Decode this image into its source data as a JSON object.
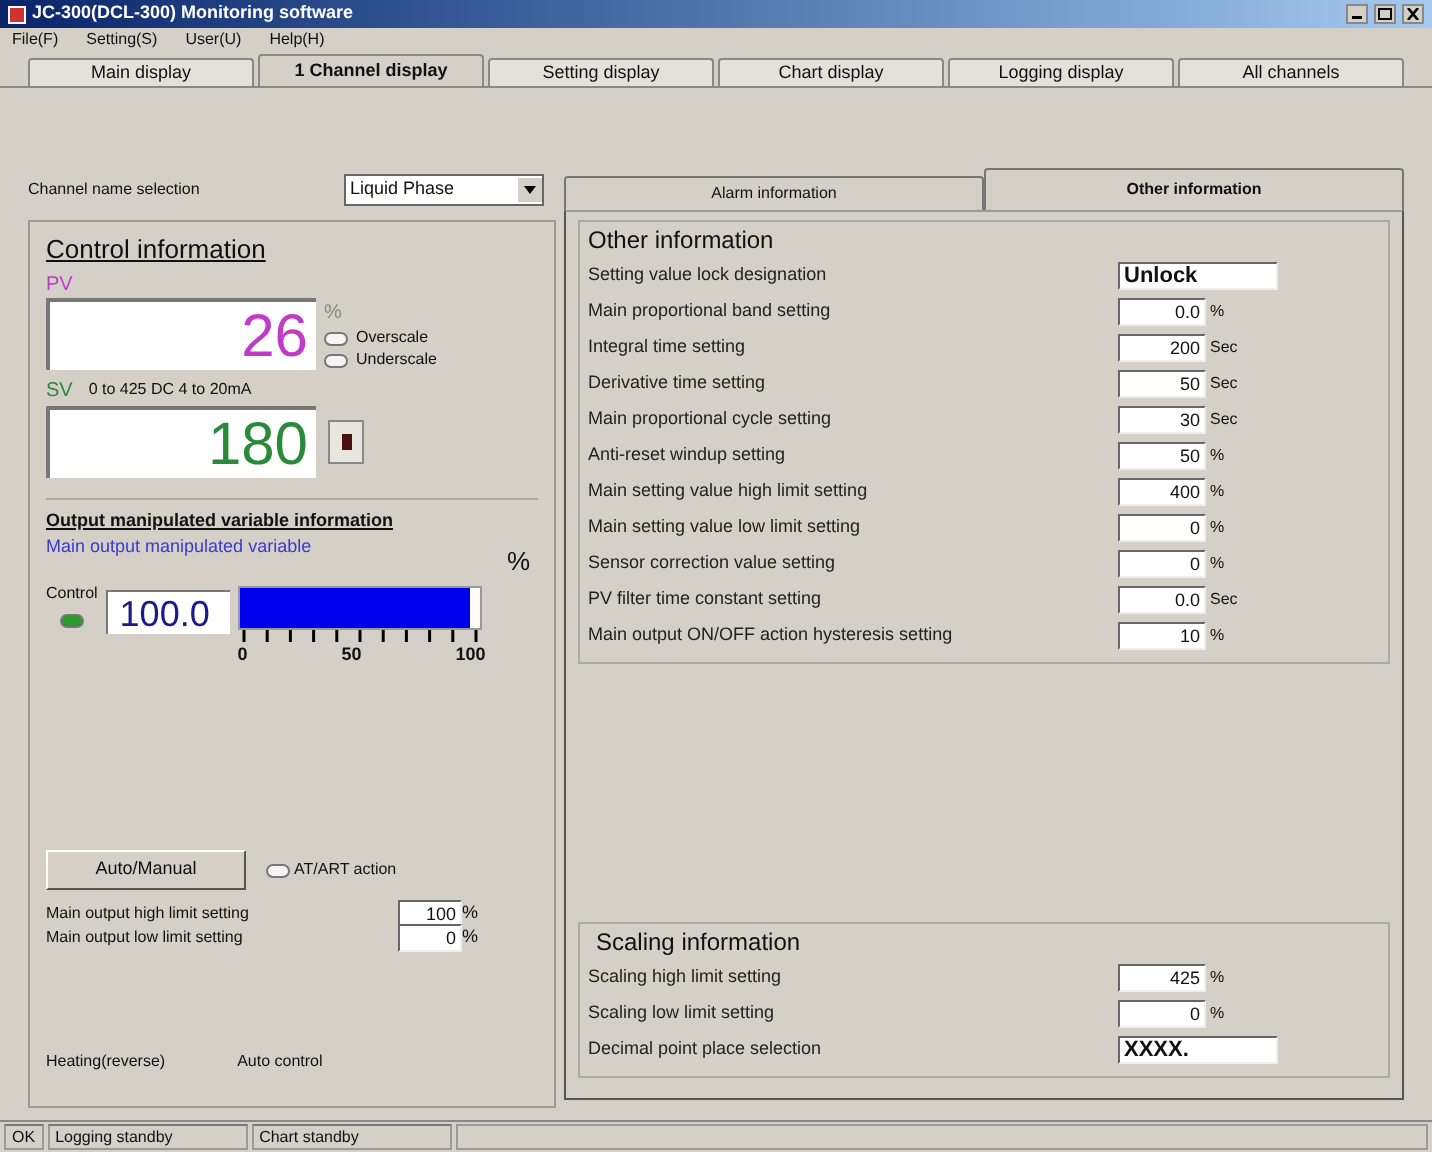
{
  "window": {
    "title": "JC-300(DCL-300) Monitoring software"
  },
  "menu": [
    "File(F)",
    "Setting(S)",
    "User(U)",
    "Help(H)"
  ],
  "tabs": [
    {
      "label": "Main display",
      "selected": false
    },
    {
      "label": "1 Channel display",
      "selected": true
    },
    {
      "label": "Setting display",
      "selected": false
    },
    {
      "label": "Chart display",
      "selected": false
    },
    {
      "label": "Logging display",
      "selected": false
    },
    {
      "label": "All channels",
      "selected": false
    }
  ],
  "channel_select": {
    "label": "Channel name selection",
    "value": "Liquid Phase"
  },
  "control": {
    "title": "Control information",
    "pv_label": "PV",
    "pv": "26",
    "pv_unit": "%",
    "lamps": [
      {
        "label": "Overscale",
        "on": false
      },
      {
        "label": "Underscale",
        "on": false
      }
    ],
    "sv_label": "SV",
    "range": "0 to 425 DC 4 to 20mA",
    "sv": "180"
  },
  "output": {
    "title": "Output manipulated variable information",
    "subtitle": "Main output manipulated variable",
    "unit": "%",
    "lamp_label": "Control",
    "lamp_on": true,
    "value": "100.0",
    "level": 1.0,
    "scale": [
      "0",
      "50",
      "100"
    ]
  },
  "auto_manual": {
    "button": "Auto/Manual",
    "lamp_label": "AT/ART action",
    "lamp_on": false
  },
  "limits": [
    {
      "label": "Main output high limit setting",
      "value": "100",
      "unit": "%"
    },
    {
      "label": "Main output low limit setting",
      "value": "0",
      "unit": "%"
    }
  ],
  "status_labels": [
    "Heating(reverse)",
    "Auto control"
  ],
  "info_tabs": [
    {
      "label": "Alarm information",
      "selected": false
    },
    {
      "label": "Other information",
      "selected": true
    }
  ],
  "other_info": {
    "title": "Other information",
    "rows": [
      {
        "label": "Setting value lock designation",
        "value": "Unlock"
      },
      {
        "label": "Main proportional band setting",
        "value": "0.0",
        "unit": "%"
      },
      {
        "label": "Integral time setting",
        "value": "200",
        "unit": "Sec"
      },
      {
        "label": "Derivative time setting",
        "value": "50",
        "unit": "Sec"
      },
      {
        "label": "Main proportional cycle setting",
        "value": "30",
        "unit": "Sec"
      },
      {
        "label": "Anti-reset windup setting",
        "value": "50",
        "unit": "%"
      },
      {
        "label": "Main setting value high limit setting",
        "value": "400",
        "unit": "%"
      },
      {
        "label": "Main setting value low limit setting",
        "value": "0",
        "unit": "%"
      },
      {
        "label": "Sensor correction value setting",
        "value": "0",
        "unit": "%"
      },
      {
        "label": "PV filter time constant setting",
        "value": "0.0",
        "unit": "Sec"
      },
      {
        "label": "Main output ON/OFF action hysteresis setting",
        "value": "10",
        "unit": "%"
      }
    ]
  },
  "scaling_info": {
    "title": "Scaling information",
    "rows": [
      {
        "label": "Scaling high limit setting",
        "value": "425",
        "unit": "%"
      },
      {
        "label": "Scaling low limit setting",
        "value": "0",
        "unit": "%"
      },
      {
        "label": "Decimal point place selection",
        "value": "XXXX."
      }
    ]
  },
  "status_bar": [
    "OK",
    "Logging standby",
    "Chart standby"
  ]
}
